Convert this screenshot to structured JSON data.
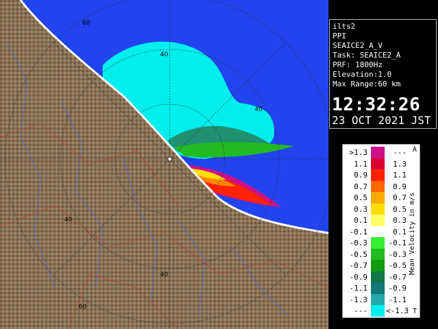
{
  "radar": {
    "site": "ilts2",
    "product": "PPI",
    "scan": "SEAICE2_A_V",
    "task": "Task: SEAICE2_A",
    "prf": "PRF: 1800Hz",
    "elevation": "Elevation:1.0",
    "max_range": "Max Range:60 km",
    "time": "12:32:26",
    "date": "23 OCT 2021 JST"
  },
  "map": {
    "range_labels": [
      "60",
      "40",
      "40",
      "40",
      "40",
      "60"
    ],
    "colors": {
      "sea": "#2244ee",
      "land": "#8a7256",
      "coast": "#ffffff"
    }
  },
  "legend": {
    "title": "Mean Velocity in m/s",
    "top_marker": "A",
    "bottom_marker": "T",
    "rows": [
      {
        "left": ">1.3",
        "right": "---",
        "color": "#cc1188"
      },
      {
        "left": "1.1",
        "right": "1.3",
        "color": "#dd0033"
      },
      {
        "left": "0.9",
        "right": "1.1",
        "color": "#ff2200"
      },
      {
        "left": "0.7",
        "right": "0.9",
        "color": "#ff6600"
      },
      {
        "left": "0.5",
        "right": "0.7",
        "color": "#ffaa00"
      },
      {
        "left": "0.3",
        "right": "0.5",
        "color": "#ffdd00"
      },
      {
        "left": "0.1",
        "right": "0.3",
        "color": "#ffff66"
      },
      {
        "left": "-0.1",
        "right": "0.1",
        "color": "#ffffff"
      },
      {
        "left": "-0.3",
        "right": "-0.1",
        "color": "#33ee33"
      },
      {
        "left": "-0.5",
        "right": "-0.3",
        "color": "#22bb22"
      },
      {
        "left": "-0.7",
        "right": "-0.5",
        "color": "#119911"
      },
      {
        "left": "-0.9",
        "right": "-0.7",
        "color": "#117744"
      },
      {
        "left": "-1.1",
        "right": "-0.9",
        "color": "#117777"
      },
      {
        "left": "-1.3",
        "right": "-1.1",
        "color": "#22aaaa"
      },
      {
        "left": "---",
        "right": "<-1.3",
        "color": "#00eeee"
      }
    ]
  }
}
